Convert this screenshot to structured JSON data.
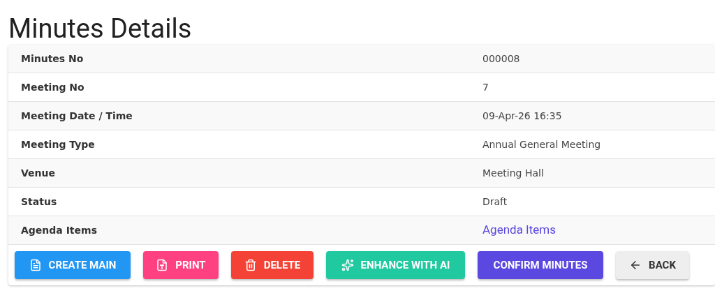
{
  "title": "Minutes Details",
  "rows": [
    {
      "label": "Minutes No",
      "value": "000008",
      "kind": "text"
    },
    {
      "label": "Meeting No",
      "value": "7",
      "kind": "text"
    },
    {
      "label": "Meeting Date / Time",
      "value": "09-Apr-26 16:35",
      "kind": "text"
    },
    {
      "label": "Meeting Type",
      "value": "Annual General Meeting",
      "kind": "text"
    },
    {
      "label": "Venue",
      "value": "Meeting Hall",
      "kind": "text"
    },
    {
      "label": "Status",
      "value": "Draft",
      "kind": "text"
    },
    {
      "label": "Agenda Items",
      "value": "Agenda Items",
      "kind": "link"
    }
  ],
  "buttons": [
    {
      "label": "CREATE MAIN",
      "kind": "create"
    },
    {
      "label": "PRINT",
      "kind": "print"
    },
    {
      "label": "DELETE",
      "kind": "delete"
    },
    {
      "label": "ENHANCE WITH AI",
      "kind": "enhance"
    },
    {
      "label": "CONFIRM MINUTES",
      "kind": "confirm"
    },
    {
      "label": "BACK",
      "kind": "back"
    }
  ]
}
